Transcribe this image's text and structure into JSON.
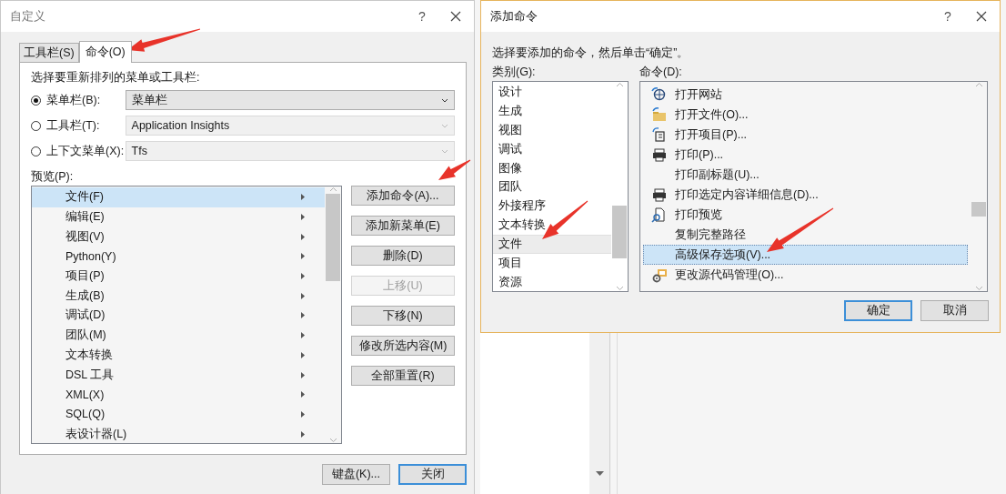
{
  "customize_dialog": {
    "title": "自定义",
    "help": "?",
    "tabs": [
      {
        "label": "工具栏(S)",
        "selected": false
      },
      {
        "label": "命令(O)",
        "selected": true
      }
    ],
    "prompt": "选择要重新排列的菜单或工具栏:",
    "options": [
      {
        "label": "菜单栏(B):",
        "selected": true,
        "value": "菜单栏"
      },
      {
        "label": "工具栏(T):",
        "selected": false,
        "value": "Application Insights"
      },
      {
        "label": "上下文菜单(X):",
        "selected": false,
        "value": "Tfs"
      }
    ],
    "preview_label": "预览(P):",
    "preview_items": [
      {
        "label": "文件(F)",
        "selected": true
      },
      {
        "label": "编辑(E)",
        "selected": false
      },
      {
        "label": "视图(V)",
        "selected": false
      },
      {
        "label": "Python(Y)",
        "selected": false
      },
      {
        "label": "项目(P)",
        "selected": false
      },
      {
        "label": "生成(B)",
        "selected": false
      },
      {
        "label": "调试(D)",
        "selected": false
      },
      {
        "label": "团队(M)",
        "selected": false
      },
      {
        "label": "文本转换",
        "selected": false
      },
      {
        "label": "DSL 工具",
        "selected": false
      },
      {
        "label": "XML(X)",
        "selected": false
      },
      {
        "label": "SQL(Q)",
        "selected": false
      },
      {
        "label": "表设计器(L)",
        "selected": false
      }
    ],
    "side_buttons": [
      {
        "label": "添加命令(A)...",
        "disabled": false
      },
      {
        "label": "添加新菜单(E)",
        "disabled": false
      },
      {
        "label": "删除(D)",
        "disabled": false
      },
      {
        "label": "上移(U)",
        "disabled": true
      },
      {
        "label": "下移(N)",
        "disabled": false
      },
      {
        "label": "修改所选内容(M)",
        "disabled": false
      },
      {
        "label": "全部重置(R)",
        "disabled": false
      }
    ],
    "footer_buttons": [
      {
        "label": "键盘(K)...",
        "default": false
      },
      {
        "label": "关闭",
        "default": true
      }
    ]
  },
  "add_command_dialog": {
    "title": "添加命令",
    "help": "?",
    "prompt": "选择要添加的命令，然后单击“确定”。",
    "categories_label": "类别(G):",
    "categories": [
      {
        "label": "设计",
        "selected": false
      },
      {
        "label": "生成",
        "selected": false
      },
      {
        "label": "视图",
        "selected": false
      },
      {
        "label": "调试",
        "selected": false
      },
      {
        "label": "图像",
        "selected": false
      },
      {
        "label": "团队",
        "selected": false
      },
      {
        "label": "外接程序",
        "selected": false
      },
      {
        "label": "文本转换",
        "selected": false
      },
      {
        "label": "文件",
        "selected": true
      },
      {
        "label": "项目",
        "selected": false
      },
      {
        "label": "资源",
        "selected": false
      }
    ],
    "commands_label": "命令(D):",
    "commands": [
      {
        "label": "打开网站",
        "kind": "icon",
        "selected": false
      },
      {
        "label": "打开文件(O)...",
        "kind": "icon",
        "selected": false
      },
      {
        "label": "打开项目(P)...",
        "kind": "icon",
        "selected": false
      },
      {
        "label": "打印(P)...",
        "kind": "icon",
        "selected": false
      },
      {
        "label": "打印副标题(U)...",
        "kind": "plain",
        "selected": false
      },
      {
        "label": "打印选定内容详细信息(D)...",
        "kind": "icon",
        "selected": false
      },
      {
        "label": "打印预览",
        "kind": "icon",
        "selected": false
      },
      {
        "label": "复制完整路径",
        "kind": "plain",
        "selected": false
      },
      {
        "label": "高级保存选项(V)...",
        "kind": "plain",
        "selected": true
      },
      {
        "label": "更改源代码管理(O)...",
        "kind": "icon",
        "selected": false
      }
    ],
    "buttons": [
      {
        "label": "确定",
        "default": true
      },
      {
        "label": "取消",
        "default": false
      }
    ]
  }
}
